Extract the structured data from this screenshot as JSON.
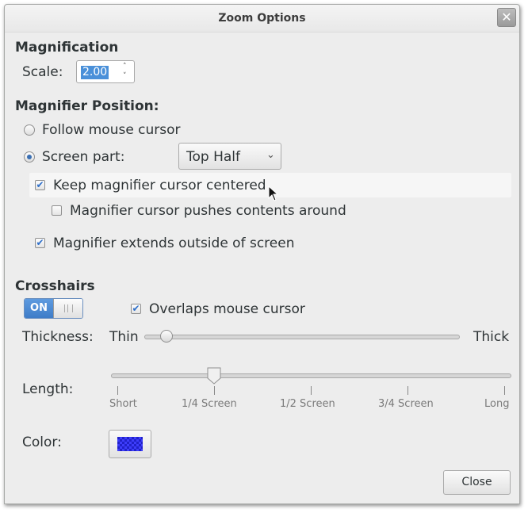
{
  "window": {
    "title": "Zoom Options",
    "close_glyph": "✕"
  },
  "magnification": {
    "heading": "Magnification",
    "scale_label": "Scale:",
    "scale_value": "2.00",
    "up_glyph": "˄",
    "down_glyph": "˅"
  },
  "position": {
    "heading": "Magnifier Position:",
    "follow_label": "Follow mouse cursor",
    "follow_selected": false,
    "screen_part_label": "Screen part:",
    "screen_part_selected": true,
    "screen_part_value": "Top Half",
    "combo_glyph": "⌄",
    "keep_centered_label": "Keep magnifier cursor centered",
    "keep_centered_checked": true,
    "pushes_label": "Magnifier cursor pushes contents around",
    "pushes_checked": false,
    "extends_label": "Magnifier extends outside of screen",
    "extends_checked": true,
    "check_glyph": "✔"
  },
  "crosshairs": {
    "heading": "Crosshairs",
    "switch_label": "ON",
    "overlaps_label": "Overlaps mouse cursor",
    "overlaps_checked": true,
    "thickness_label": "Thickness:",
    "thin_label": "Thin",
    "thick_label": "Thick",
    "thickness_fraction": 0.07,
    "length_label": "Length:",
    "length_marks": [
      "Short",
      "1/4 Screen",
      "1/2 Screen",
      "3/4 Screen",
      "Long"
    ],
    "length_fraction": 0.25,
    "color_label": "Color:",
    "color_value": "#2121c9"
  },
  "footer": {
    "close_label": "Close"
  }
}
